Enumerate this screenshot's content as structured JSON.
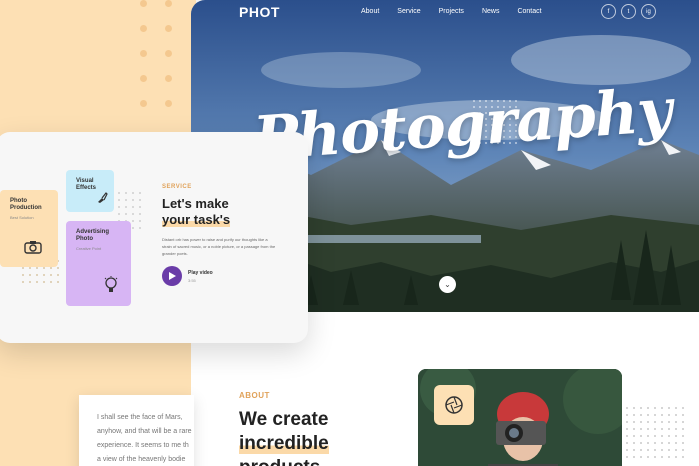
{
  "header": {
    "brand": "PHOT",
    "nav": [
      "About",
      "Service",
      "Projects",
      "News",
      "Contact"
    ],
    "socials": [
      "f",
      "t",
      "ig"
    ],
    "hero_title": "Photography"
  },
  "service": {
    "label": "SERVICE",
    "heading_line1": "Let's make",
    "heading_line2": "your task's",
    "description": "Distant orb has power to raise and purify our thoughts like a strain of sacred music, or a noble picture, or a passage from the grander poets.",
    "play_label": "Play video",
    "play_duration": "3:55",
    "tiles": [
      {
        "title_line1": "Photo",
        "title_line2": "Production",
        "subtitle": "Best Solution"
      },
      {
        "title_line1": "Visual",
        "title_line2": "Effects",
        "subtitle": ""
      },
      {
        "title_line1": "Advertising",
        "title_line2": "Photo",
        "subtitle": "Creative Point"
      }
    ]
  },
  "about": {
    "label": "ABOUT",
    "heading_line1": "We create",
    "heading_line2": "incredible",
    "heading_line3": "products"
  },
  "quote": {
    "text": "I shall see the face of Mars,\nanyhow, and that will be a rare\nexperience. It seems to me th\na view of the heavenly bodie"
  },
  "colors": {
    "peach": "#fde0b4",
    "accent": "#e0a25a",
    "purple": "#6a3ca8"
  }
}
